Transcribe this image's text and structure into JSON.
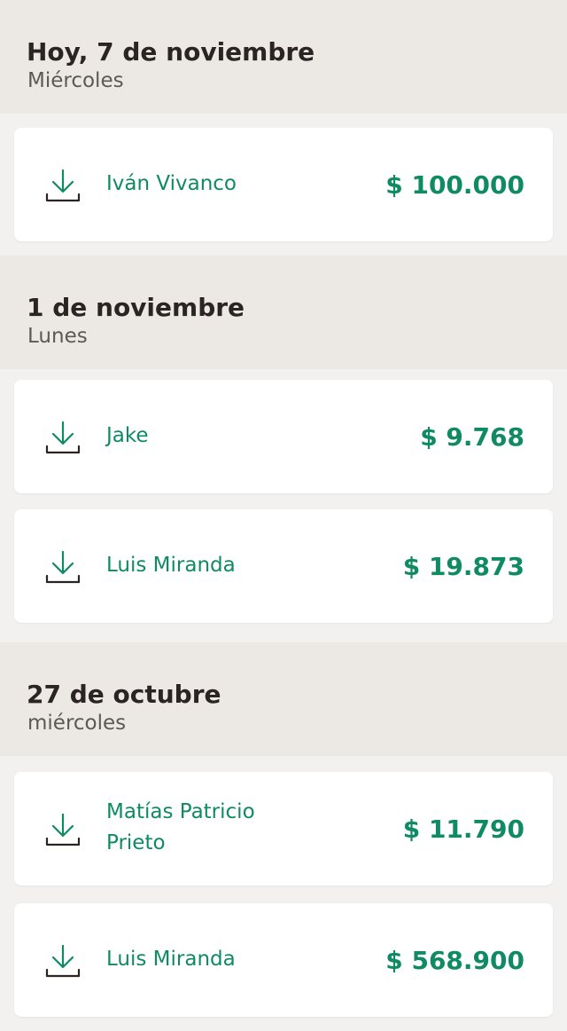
{
  "groups": [
    {
      "title": "Hoy, 7 de noviembre",
      "subtitle": "Miércoles",
      "items": [
        {
          "name": "Iván Vivanco",
          "amount": "$ 100.000",
          "icon": "download-icon"
        }
      ]
    },
    {
      "title": "1 de noviembre",
      "subtitle": "Lunes",
      "items": [
        {
          "name": "Jake",
          "amount": "$ 9.768",
          "icon": "download-icon"
        },
        {
          "name": "Luis Miranda",
          "amount": "$ 19.873",
          "icon": "download-icon"
        }
      ]
    },
    {
      "title": "27 de octubre",
      "subtitle": "miércoles",
      "items": [
        {
          "name": "Matías Patricio Prieto",
          "amount": "$ 11.790",
          "icon": "download-icon"
        },
        {
          "name": "Luis Miranda",
          "amount": "$ 568.900",
          "icon": "download-icon"
        }
      ]
    }
  ],
  "colors": {
    "accent": "#0f8a63",
    "header_bg": "#ece9e5",
    "page_bg": "#f2f1ef",
    "card_bg": "#ffffff",
    "title_text": "#2a2522",
    "subtitle_text": "#5c5955"
  }
}
